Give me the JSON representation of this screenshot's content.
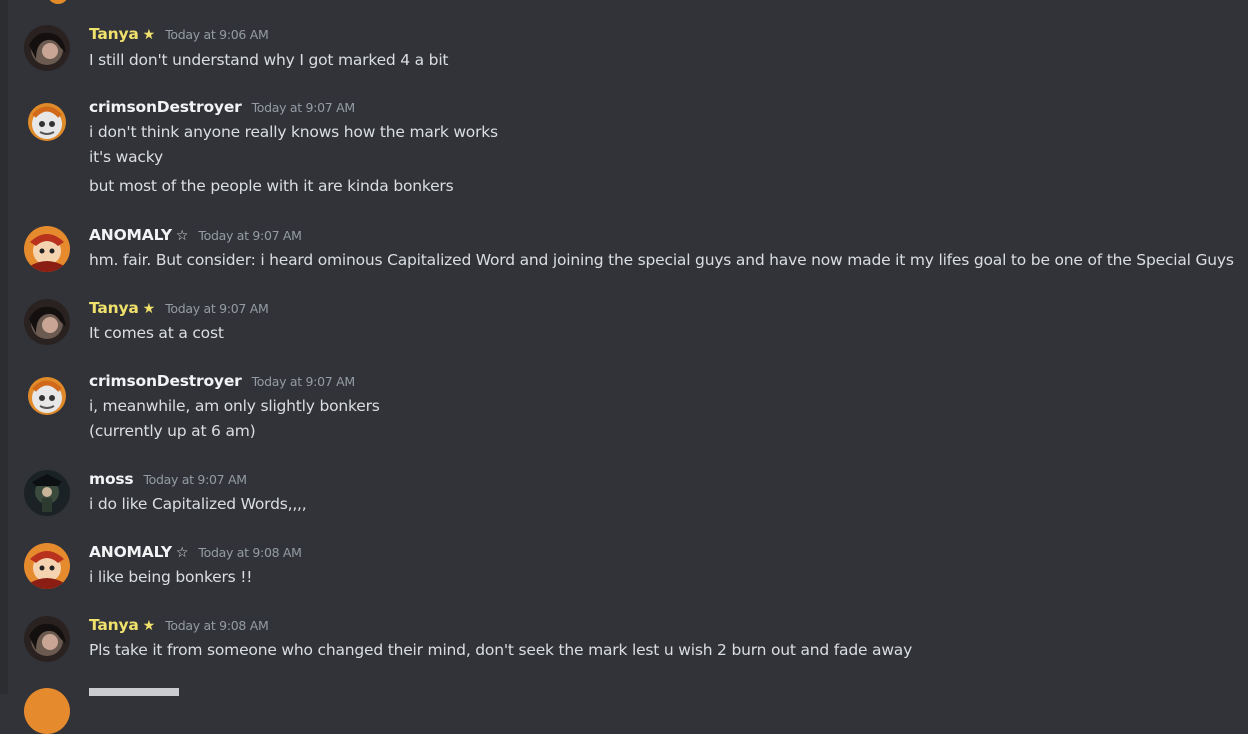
{
  "messages": [
    {
      "author": "Tanya",
      "badge": "★",
      "time": "Today at 9:06 AM",
      "lines": [
        "I still don't understand why I got marked 4 a bit"
      ]
    },
    {
      "author": "crimsonDestroyer",
      "badge": "",
      "time": "Today at 9:07 AM",
      "lines": [
        "i don't think anyone really knows how the mark works",
        "it's wacky",
        "but most of the people with it are kinda bonkers"
      ]
    },
    {
      "author": "ANOMALY",
      "badge": "☆",
      "time": "Today at 9:07 AM",
      "lines": [
        "hm. fair. But consider: i heard ominous Capitalized Word and joining the special guys and have now made it my lifes goal to be one of the Special Guys"
      ]
    },
    {
      "author": "Tanya",
      "badge": "★",
      "time": "Today at 9:07 AM",
      "lines": [
        "It comes at a cost"
      ]
    },
    {
      "author": "crimsonDestroyer",
      "badge": "",
      "time": "Today at 9:07 AM",
      "lines": [
        "i, meanwhile, am only slightly bonkers",
        "(currently up at 6 am)"
      ]
    },
    {
      "author": "moss",
      "badge": "",
      "time": "Today at 9:07 AM",
      "lines": [
        "i do like Capitalized Words,,,,"
      ]
    },
    {
      "author": "ANOMALY",
      "badge": "☆",
      "time": "Today at 9:08 AM",
      "lines": [
        "i like being bonkers !!"
      ]
    },
    {
      "author": "Tanya",
      "badge": "★",
      "time": "Today at 9:08 AM",
      "lines": [
        "Pls take it from someone who changed their mind, don't seek the mark lest u wish 2 burn out and fade away"
      ]
    }
  ],
  "colors": {
    "background": "#313338",
    "tanya_name": "#f0e06c",
    "name": "#f2f3f5",
    "text": "#dbdee1",
    "timestamp": "#949ba4"
  }
}
